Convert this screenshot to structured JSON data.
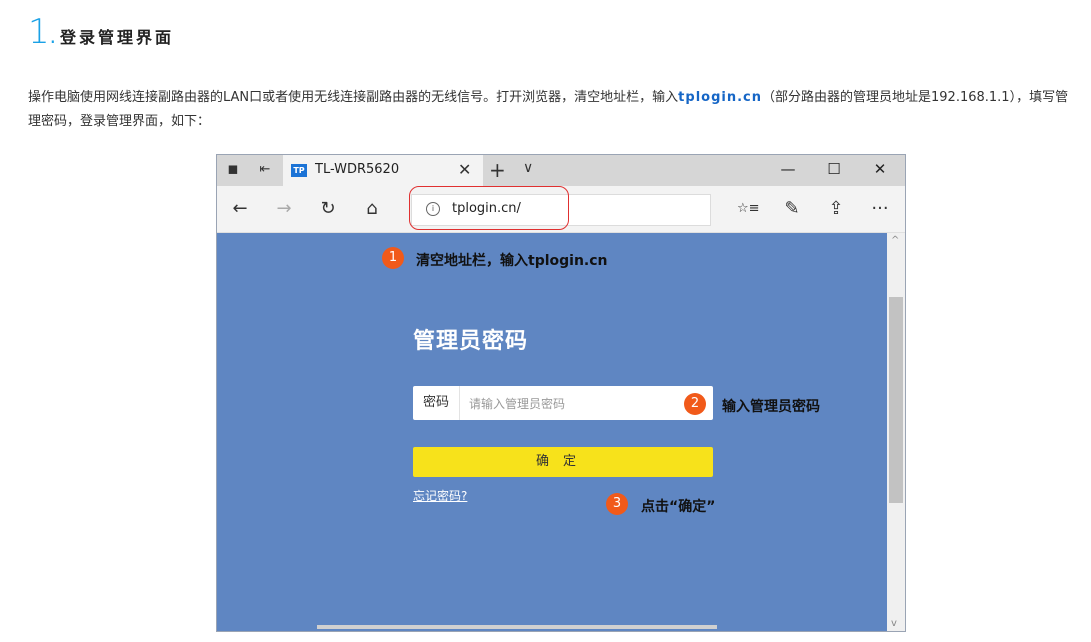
{
  "heading": {
    "number": "1",
    "dot": ".",
    "title": "登录管理界面"
  },
  "intro": {
    "before": "操作电脑使用网线连接副路由器的LAN口或者使用无线连接副路由器的无线信号。打开浏览器，清空地址栏，输入",
    "link": "tplogin.cn",
    "after": "（部分路由器的管理员地址是192.168.1.1），填写管理密码，登录管理界面，如下："
  },
  "browser": {
    "tab": {
      "logo": "TP",
      "title": "TL-WDR5620",
      "close": "✕"
    },
    "new_tab": "+",
    "tab_menu": "∨",
    "window_controls": {
      "minimize": "—",
      "maximize": "☐",
      "close": "✕"
    },
    "nav": {
      "back": "←",
      "forward": "→",
      "refresh": "↻",
      "home": "⌂",
      "favorites": "☆≡",
      "notes": "✎",
      "share": "⇪",
      "more": "···"
    },
    "address": {
      "info": "i",
      "url": "tplogin.cn/"
    },
    "scroll": {
      "up": "^",
      "down": "v"
    }
  },
  "login": {
    "title": "管理员密码",
    "password_label": "密码",
    "password_placeholder": "请输入管理员密码",
    "confirm": "确定",
    "forgot": "忘记密码?"
  },
  "annotations": [
    {
      "num": "1",
      "text": "清空地址栏，输入tplogin.cn"
    },
    {
      "num": "2",
      "text": "输入管理员密码"
    },
    {
      "num": "3",
      "text": "点击“确定”"
    }
  ],
  "colors": {
    "accent": "#1aa1e6",
    "page_bg": "#5f86c2",
    "button": "#f7e21b",
    "annotation": "#f15a1a",
    "highlight": "#e03030"
  }
}
